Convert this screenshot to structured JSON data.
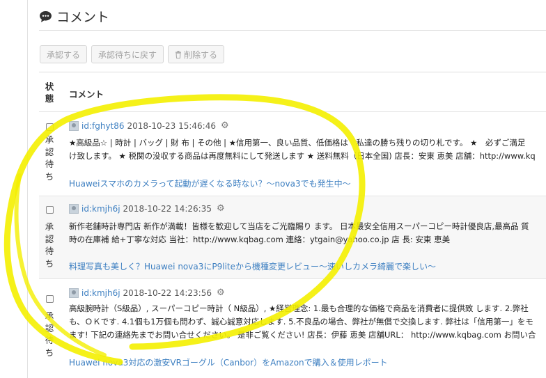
{
  "header": {
    "title": "コメント",
    "icon": "comment-icon"
  },
  "toolbar": {
    "approve_label": "承認する",
    "revert_label": "承認待ちに戻す",
    "delete_label": "削除する",
    "delete_icon": "trash-icon"
  },
  "table": {
    "col_status": "状態",
    "col_comment": "コメント"
  },
  "comments": [
    {
      "status": "承認待ち",
      "user": "id:fghyt86",
      "date": "2018-10-23 15:46:46",
      "lines": [
        "★高級品☆ | 時計 | バッグ | 財 布 | その他 | ★信用第一、良い品質、低価格は　私達の勝ち残りの切り札です。 ★　必ずご満足",
        "け致します。 ★ 税関の没収する商品は再度無料にして発送します ★ 送料無料（日本全国) 店長：安東 恵美 店舗：http://www.kq"
      ],
      "entry": "Huaweiスマホのカメラって起動が遅くなる時ない？～nova3でも発生中～"
    },
    {
      "status": "承認待ち",
      "user": "id:kmjh6j",
      "date": "2018-10-22 14:26:35",
      "lines": [
        "新作老舗時計専門店 新作が満載！皆様を歓迎して当店をご光臨賜り ます。 日本最安全信用スーパーコピー時計優良店,最高品 質",
        "時の在庫補 給+丁寧な対応 当社：http://www.kqbag.com 連絡：ytgain@yahoo.co.jp 店 長: 安東 恵美"
      ],
      "entry": "料理写真も美しく？Huawei nova3にP9liteから機種変更レビュー～速いしカメラ綺麗で楽しい～"
    },
    {
      "status": "承認待ち",
      "user": "id:kmjh6j",
      "date": "2018-10-22 14:23:56",
      "lines": [
        "高級腕時計（S級品）, スーパーコピー時計（ N級品）, ★経営理念: 1.最も合理的な価格で商品を消費者に提供致 します. 2.弊社",
        "も、ＯＫです. 4.1個も1万個も問わず、誠心誠意対応します. 5.不良品の場合、弊社が無償で交換します. 弊社は「信用第一」をモ",
        "ます! 下記の連絡先までお問い合せください。 是非ご覧ください! 店長：伊藤 恵美 店舗URL： http://www.kqbag.com お問い合"
      ],
      "entry": "Huawei nova3対応の激安VRゴーグル（Canbor）をAmazonで購入＆使用レポート"
    }
  ],
  "colors": {
    "link": "#3d7fc1",
    "highlight": "#f4ef00"
  }
}
